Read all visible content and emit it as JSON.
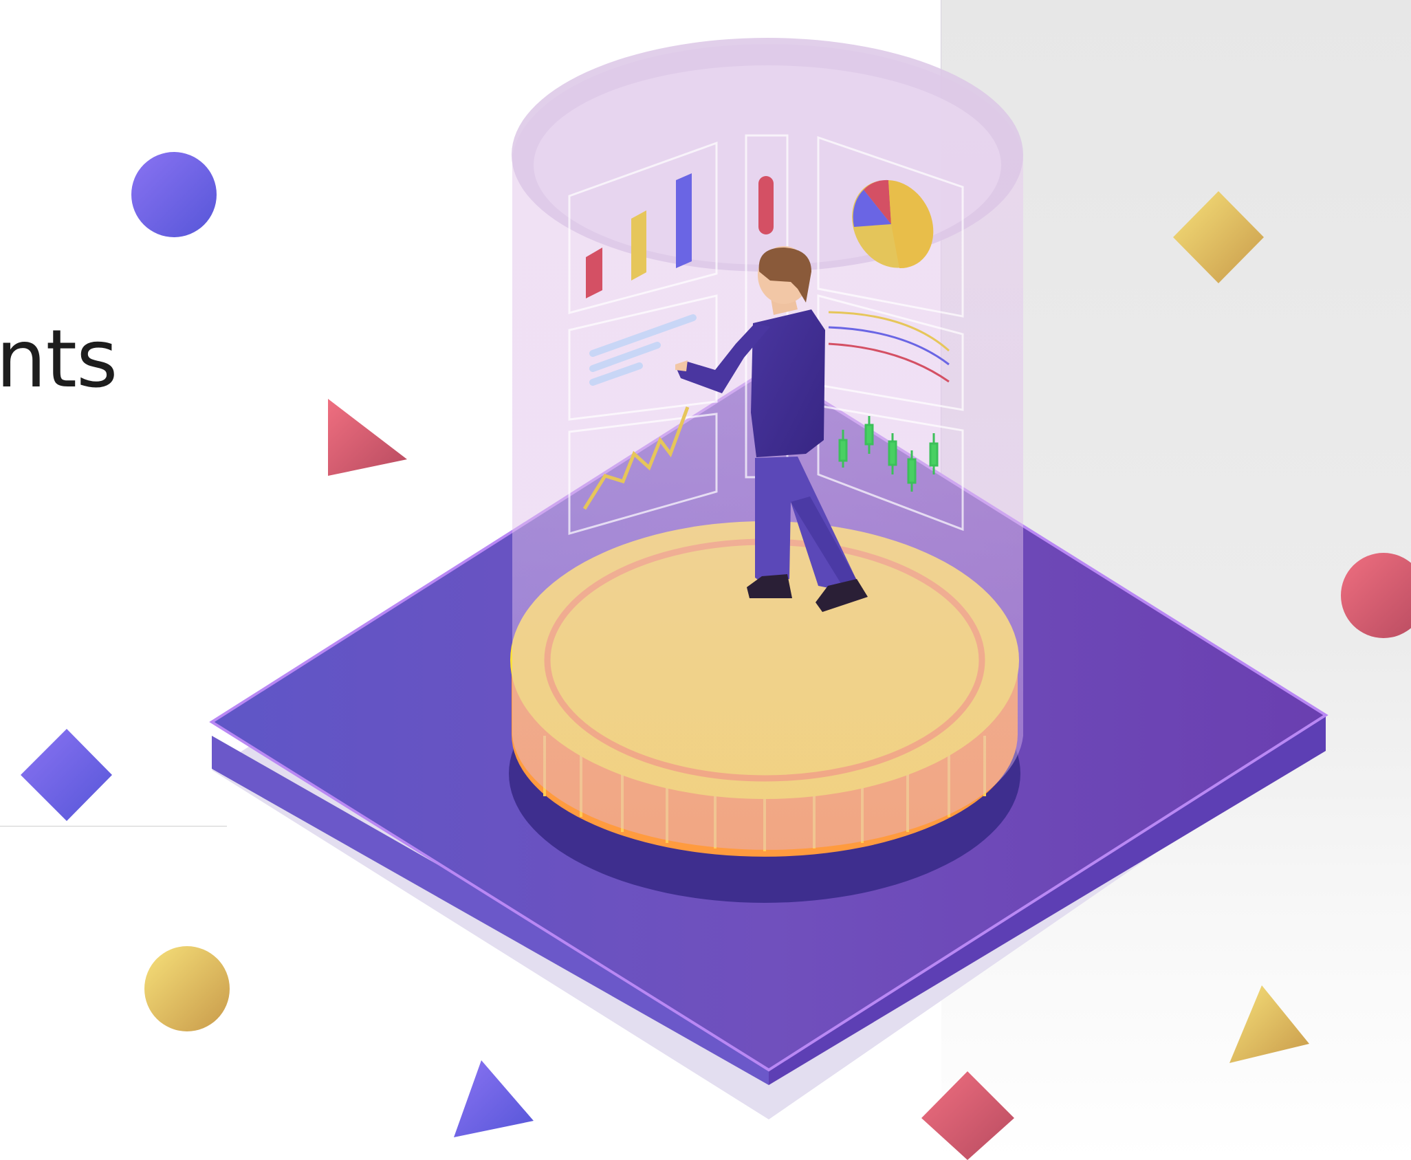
{
  "headline": {
    "text": "nts"
  },
  "colors": {
    "platform": "#6c4cc0",
    "coin": "#ffe23a",
    "coin_edge": "#ff9b3f",
    "hologram": "#e7c8ef",
    "red_shape": "#e05a6c",
    "yellow_shape": "#f2d15a",
    "blue_shape": "#6b68ea"
  },
  "illustration": {
    "scene": "isometric-coin-platform",
    "figure": "man-viewing-charts",
    "icons": [
      "bar-chart-icon",
      "pie-chart-icon",
      "line-chart-icon",
      "candlestick-chart-icon"
    ]
  }
}
